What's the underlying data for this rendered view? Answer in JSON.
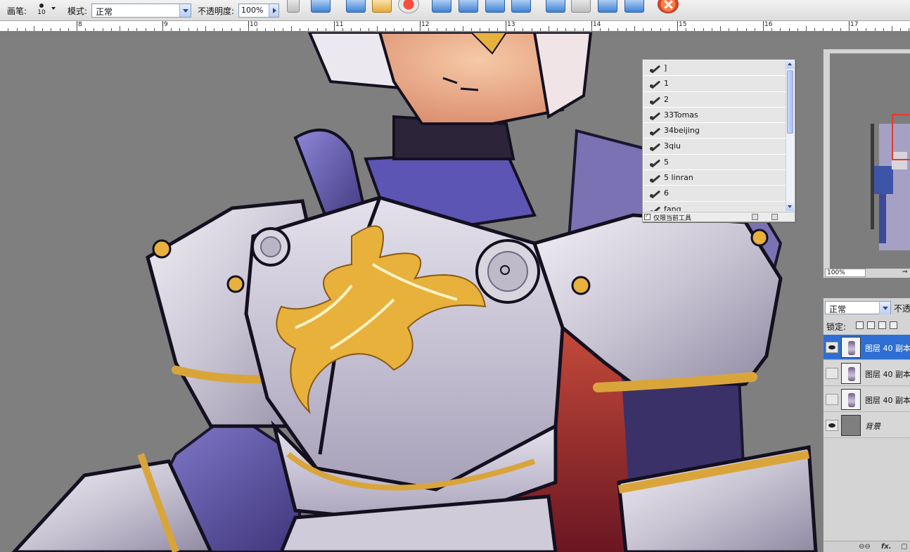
{
  "options_bar": {
    "brush_label": "画笔:",
    "brush_size": "10",
    "mode_label": "模式:",
    "mode_value": "正常",
    "opacity_label": "不透明度:",
    "opacity_value": "100%"
  },
  "ruler": {
    "numbers": [
      "8",
      "9",
      "10",
      "11",
      "12",
      "13",
      "14",
      "15",
      "16",
      "17"
    ]
  },
  "brush_presets": {
    "items": [
      "]",
      "1",
      "2",
      "33Tomas",
      "34beijing",
      "3qiu",
      "5",
      "5 linran",
      "6",
      "fang"
    ],
    "footer_checkbox_label": "仅限当前工具"
  },
  "navigator": {
    "zoom": "100%"
  },
  "layers": {
    "blend_mode": "正常",
    "opacity_label": "不透",
    "lock_label": "锁定:",
    "rows": [
      {
        "name": "图层 40 副本",
        "visible": true,
        "selected": true
      },
      {
        "name": "图层 40 副本",
        "visible": false,
        "selected": false
      },
      {
        "name": "图层 40 副本",
        "visible": false,
        "selected": false
      },
      {
        "name": "背景",
        "visible": true,
        "selected": false
      }
    ]
  },
  "colors": {
    "selection": "#2f6fd3",
    "canvas_bg": "#7f7f7f",
    "armor_gold": "#e8b23a",
    "armor_purple": "#5b4ea1"
  }
}
